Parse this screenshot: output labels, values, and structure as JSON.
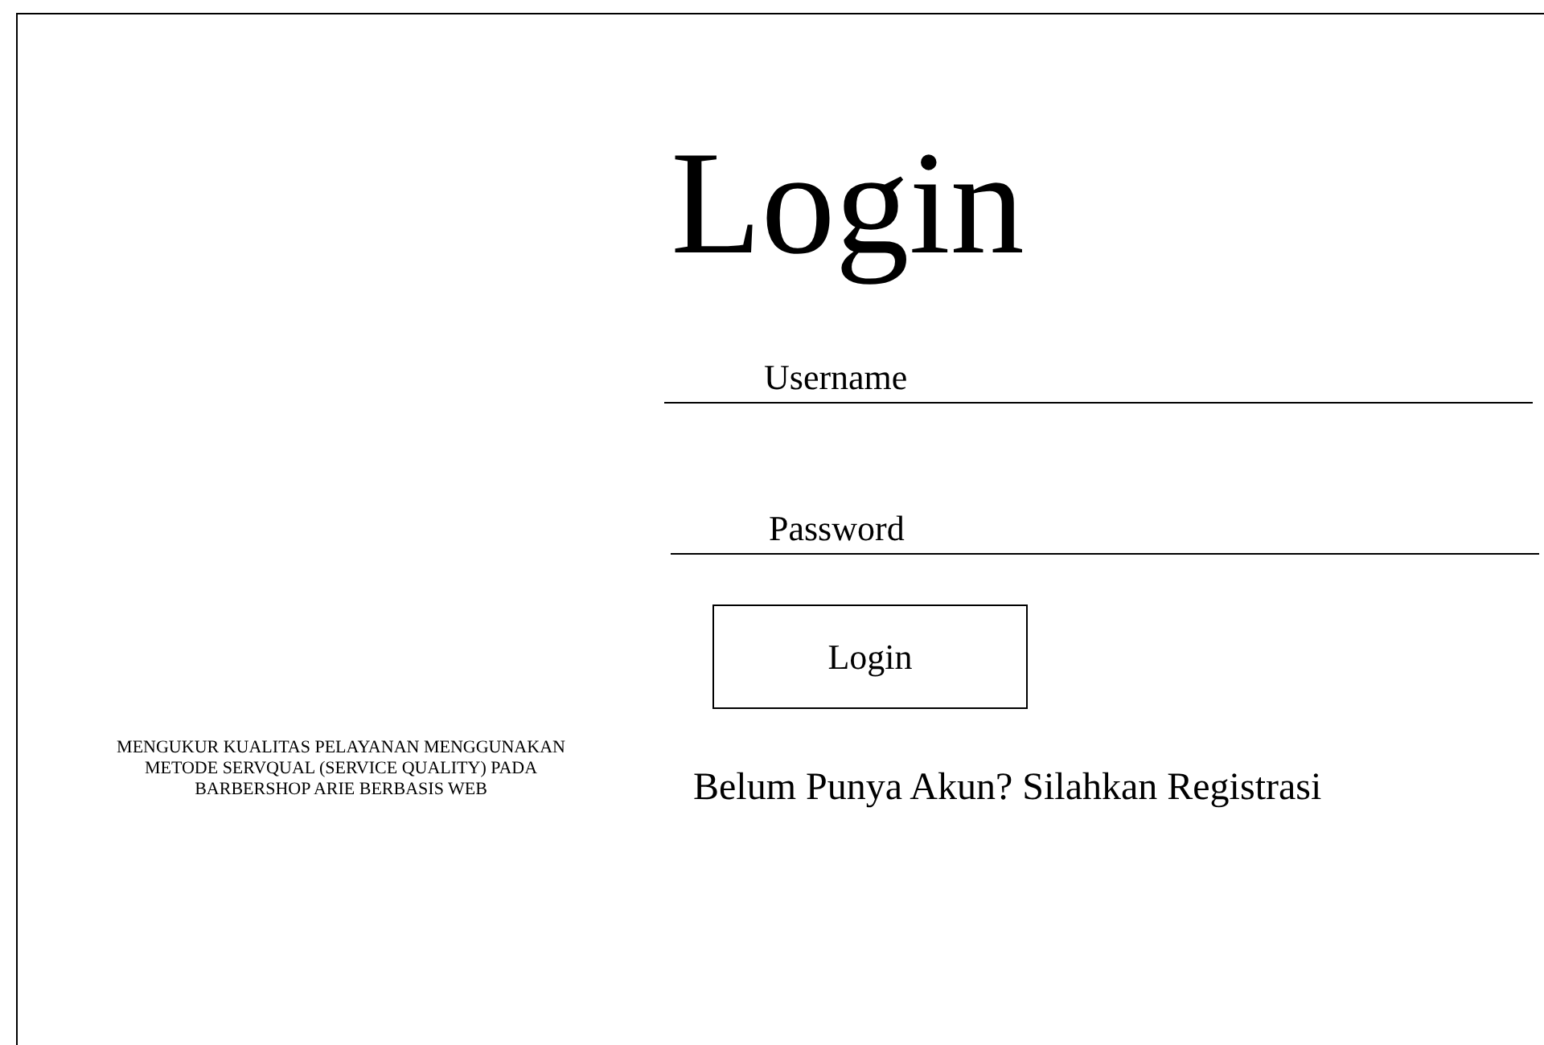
{
  "app_title": "MENGUKUR KUALITAS PELAYANAN MENGGUNAKAN METODE SERVQUAL (SERVICE QUALITY) PADA BARBERSHOP ARIE BERBASIS WEB",
  "login": {
    "heading": "Login",
    "fields": [
      {
        "placeholder": "Username"
      },
      {
        "placeholder": "Password"
      }
    ],
    "button": "Login",
    "register_link": "Belum Punya Akun? Silahkan Registrasi"
  }
}
